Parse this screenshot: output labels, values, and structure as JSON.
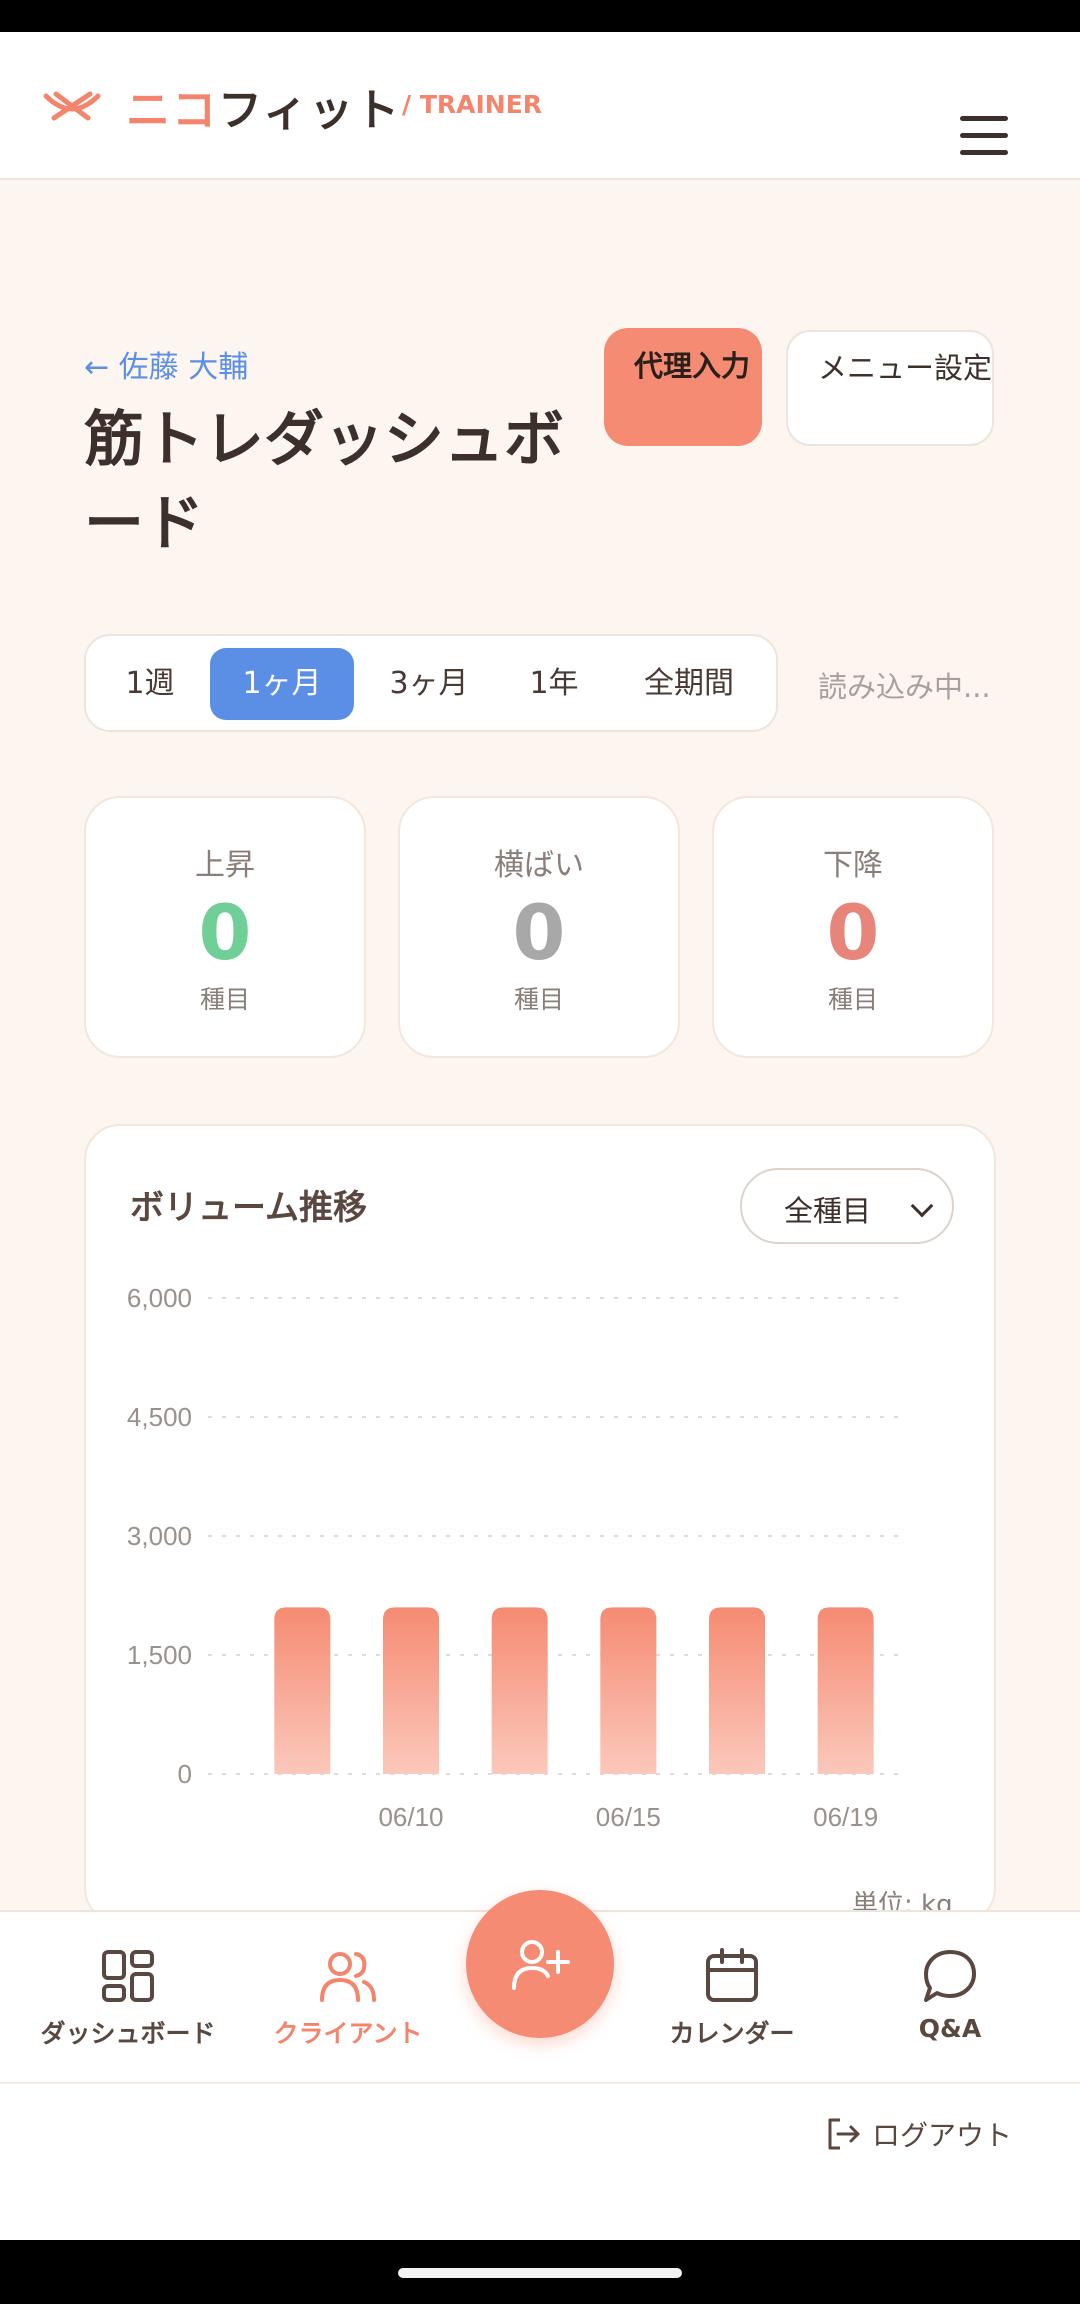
{
  "header": {
    "brand_nico": "ニコ",
    "brand_fit": "フィット",
    "role": "/ TRAINER"
  },
  "page": {
    "back_link": "← 佐藤 大輔",
    "title": "筋トレダッシュボード",
    "proxy_input_label": "代理入力",
    "menu_setting_label": "メニュー設定"
  },
  "period_tabs": {
    "tabs": [
      "1週",
      "1ヶ月",
      "3ヶ月",
      "1年",
      "全期間"
    ],
    "active": "1ヶ月",
    "status": "読み込み中..."
  },
  "stats": [
    {
      "label": "上昇",
      "value": "0",
      "unit": "種目",
      "color": "#6fcf97"
    },
    {
      "label": "横ばい",
      "value": "0",
      "unit": "種目",
      "color": "#a8a8a8"
    },
    {
      "label": "下降",
      "value": "0",
      "unit": "種目",
      "color": "#e8857a"
    }
  ],
  "chart": {
    "title": "ボリューム推移",
    "select_value": "全種目",
    "unit": "単位: kg"
  },
  "chart_data": {
    "type": "bar",
    "title": "ボリューム推移",
    "categories": [
      "",
      "06/10",
      "",
      "06/15",
      "",
      "06/19"
    ],
    "values": [
      2100,
      2100,
      2100,
      2100,
      2100,
      2100
    ],
    "ylim": [
      0,
      6000
    ],
    "yticks": [
      "0",
      "1,500",
      "3,000",
      "4,500",
      "6,000"
    ],
    "ytick_values": [
      0,
      1500,
      3000,
      4500,
      6000
    ],
    "ylabel": "",
    "xlabel": "",
    "grid": true,
    "bar_color": "#f58b72"
  },
  "bottom_nav": {
    "items": [
      {
        "label": "ダッシュボード",
        "icon": "grid-icon"
      },
      {
        "label": "クライアント",
        "icon": "users-icon",
        "active": true
      },
      {
        "label": "カレンダー",
        "icon": "calendar-icon"
      },
      {
        "label": "Q&A",
        "icon": "chat-icon"
      }
    ],
    "fab_icon": "add-user-icon"
  },
  "footer": {
    "logout_label": "ログアウト"
  },
  "colors": {
    "accent": "#f58b72",
    "blue": "#5b8fe6",
    "background": "#fdf6f0"
  }
}
